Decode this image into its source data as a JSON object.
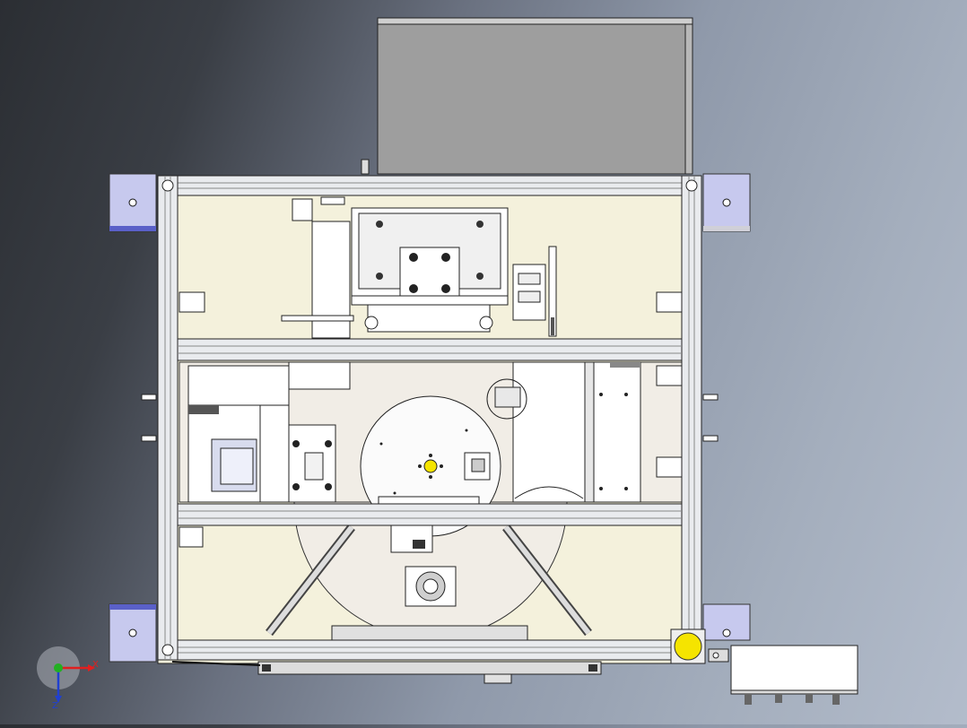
{
  "view": {
    "kind": "CAD top view",
    "background_colors": [
      "#2b2e33",
      "#8f99aa",
      "#b3bccb"
    ],
    "frame_color": "#f4f1dc",
    "profile_color": "#e9ebee",
    "bracket_color": "#c7c9ee",
    "cover_color": "#9e9e9e",
    "button_color": "#f5e400"
  },
  "triad": {
    "x_label": "X",
    "z_label": "Z",
    "x_color": "#e0201f",
    "y_color": "#22b022",
    "z_color": "#2040d0"
  }
}
